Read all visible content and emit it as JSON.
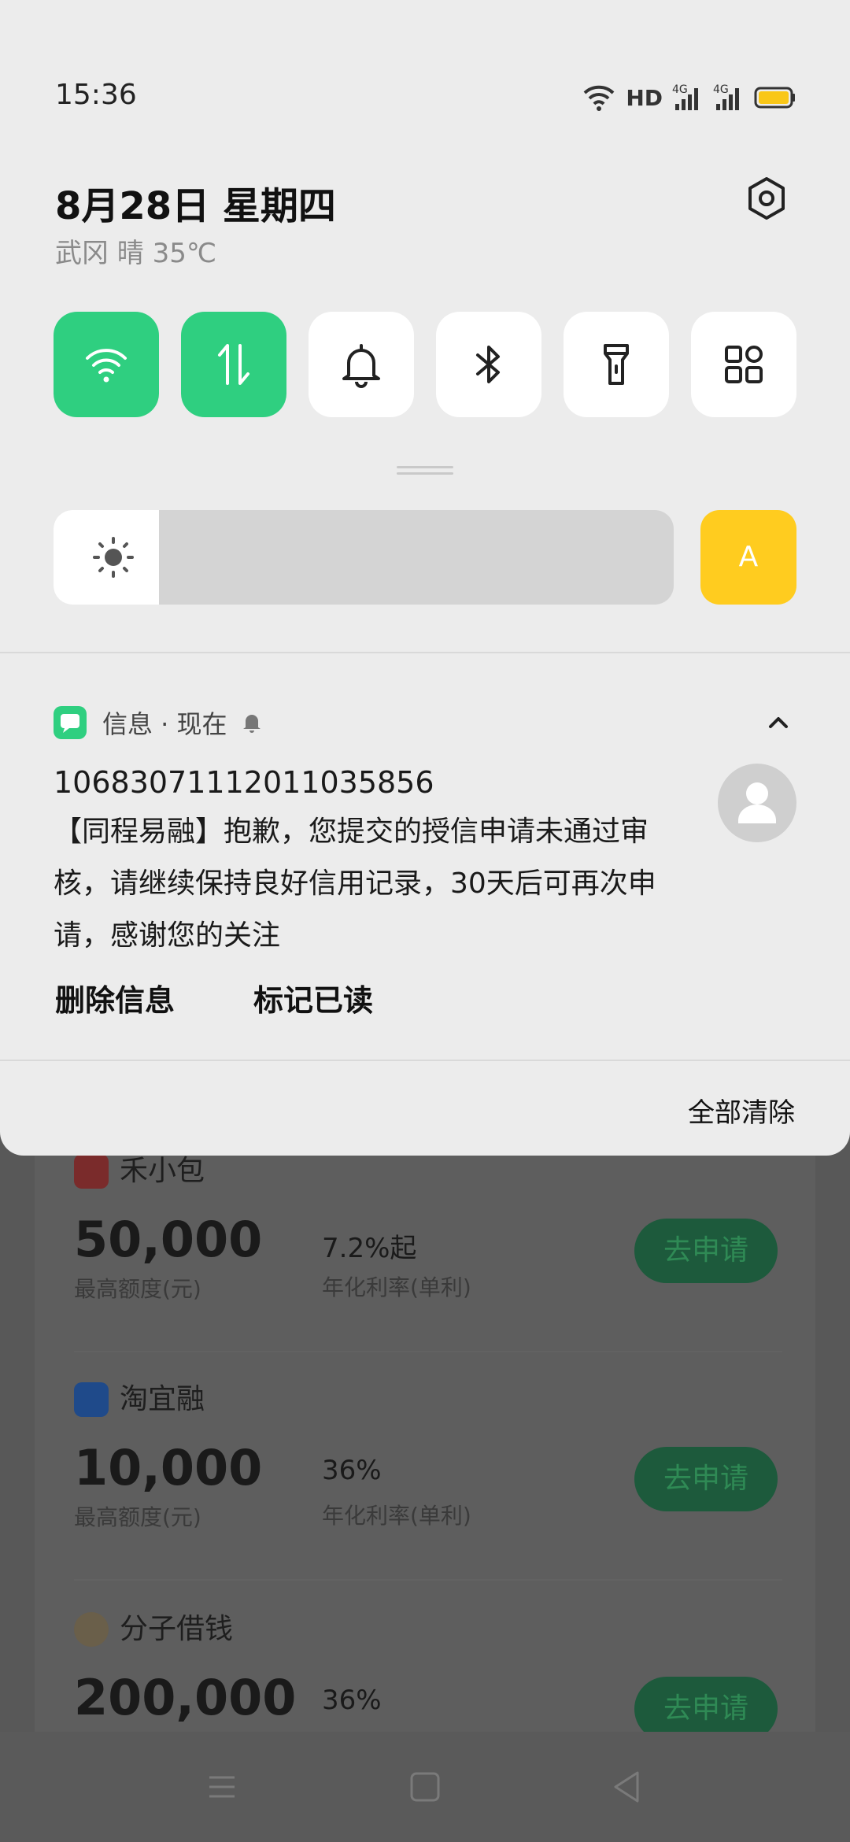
{
  "status_bar": {
    "time": "15:36",
    "hd_label": "HD",
    "network_labels": [
      "4G",
      "4G"
    ],
    "battery_color": "#f9c718"
  },
  "header": {
    "date": "8月28日  星期四",
    "weather": "武冈 晴 35℃"
  },
  "quick_tiles": [
    {
      "name": "wifi",
      "icon": "wifi-icon",
      "active": true
    },
    {
      "name": "mobile-data",
      "icon": "data-arrows-icon",
      "active": true
    },
    {
      "name": "sound",
      "icon": "bell-icon",
      "active": false
    },
    {
      "name": "bluetooth",
      "icon": "bluetooth-icon",
      "active": false
    },
    {
      "name": "flashlight",
      "icon": "flashlight-icon",
      "active": false
    },
    {
      "name": "more",
      "icon": "grid-icon",
      "active": false
    }
  ],
  "brightness": {
    "level": 0.17,
    "auto_label": "A"
  },
  "notification": {
    "app_name": "信息 · 现在",
    "sender": "10683071112011035856",
    "body": "【同程易融】抱歉，您提交的授信申请未通过审核，请继续保持良好信用记录，30天后可再次申请，感谢您的关注",
    "actions": [
      "删除信息",
      "标记已读"
    ]
  },
  "clear_all_label": "全部清除",
  "background_app": {
    "loans": [
      {
        "name": "禾小包",
        "amount": "50,000",
        "amount_label": "最高额度(元)",
        "rate": "7.2%起",
        "rate_label": "年化利率(单利)",
        "button": "去申请"
      },
      {
        "name": "淘宜融",
        "amount": "10,000",
        "amount_label": "最高额度(元)",
        "rate": "36%",
        "rate_label": "年化利率(单利)",
        "button": "去申请"
      },
      {
        "name": "分子借钱",
        "amount": "200,000",
        "amount_label": "",
        "rate": "36%",
        "rate_label": "",
        "button": "去申请"
      }
    ]
  },
  "colors": {
    "accent_green": "#2fcf80",
    "auto_yellow": "#ffcc1f",
    "shade_bg": "#ececec"
  }
}
